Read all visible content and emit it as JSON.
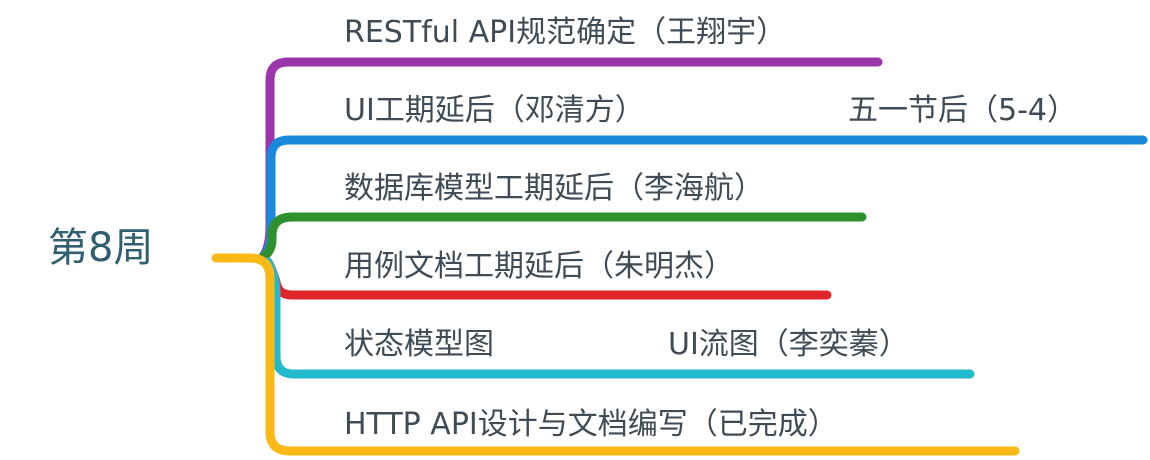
{
  "root": {
    "label": "第8周"
  },
  "branches": [
    {
      "label": "RESTful API规范确定（王翔宇）",
      "color": "#9b35aa"
    },
    {
      "label": "UI工期延后（邓清方）",
      "note": "五一节后（5-4）",
      "color": "#1a89db"
    },
    {
      "label": "数据库模型工期延后（李海航）",
      "color": "#2e912e"
    },
    {
      "label": "用例文档工期延后（朱明杰）",
      "color": "#e0262b"
    },
    {
      "label": "状态模型图",
      "note": "UI流图（李奕蓁）",
      "color": "#22b9cc"
    },
    {
      "label": "HTTP API设计与文档编写（已完成）",
      "color": "#fbb915"
    }
  ]
}
